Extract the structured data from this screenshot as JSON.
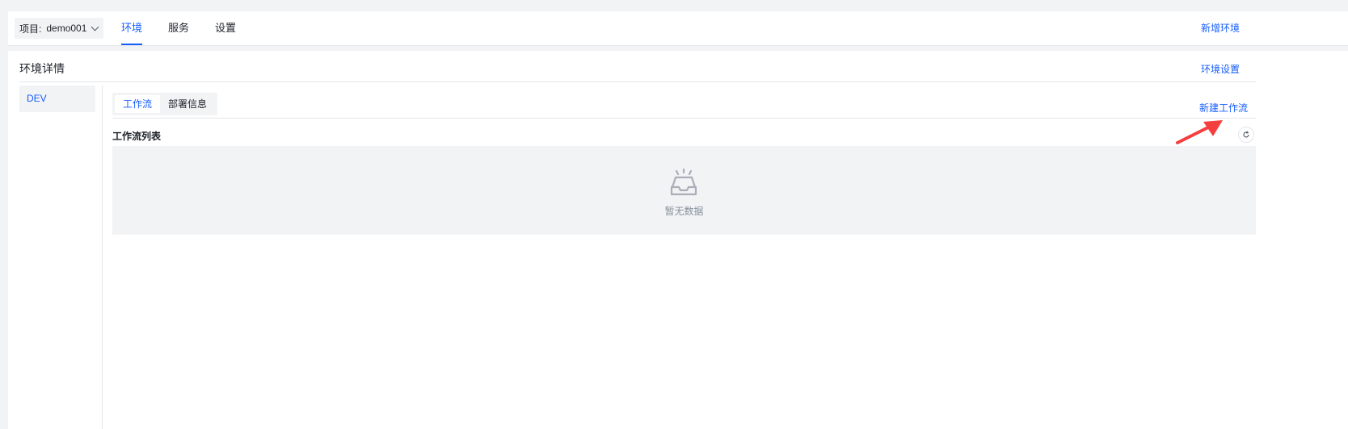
{
  "header": {
    "project_label": "项目:",
    "project_value": "demo001",
    "tabs": [
      {
        "label": "环境",
        "active": true
      },
      {
        "label": "服务",
        "active": false
      },
      {
        "label": "设置",
        "active": false
      }
    ],
    "new_env_label": "新增环境"
  },
  "panel": {
    "title": "环境详情",
    "env_settings_label": "环境设置",
    "environments": [
      {
        "label": "DEV",
        "selected": true
      }
    ],
    "segmented": [
      {
        "label": "工作流",
        "active": true
      },
      {
        "label": "部署信息",
        "active": false
      }
    ],
    "new_workflow_label": "新建工作流",
    "list_title": "工作流列表",
    "empty_text": "暂无数据"
  },
  "colors": {
    "accent": "#165dff",
    "annotation_arrow": "#f53f3f"
  }
}
